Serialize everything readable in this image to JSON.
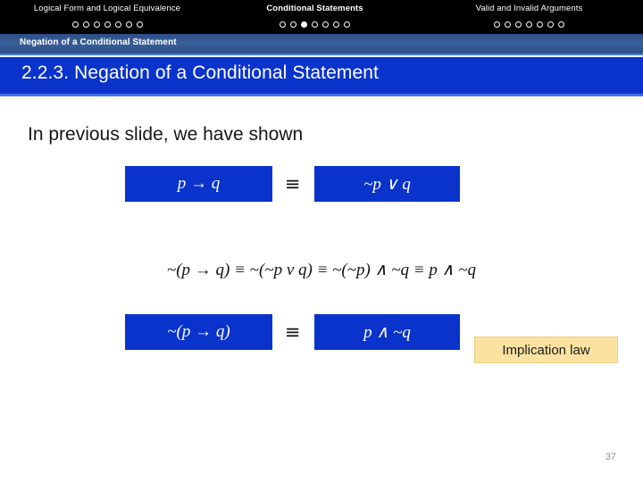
{
  "nav": {
    "groups": [
      {
        "label": "Logical Form and Logical Equivalence",
        "current": false,
        "dots": [
          false,
          false,
          false,
          false,
          false,
          false,
          false
        ]
      },
      {
        "label": "Conditional Statements",
        "current": true,
        "dots": [
          false,
          false,
          true,
          false,
          false,
          false,
          false
        ]
      },
      {
        "label": "Valid and Invalid Arguments",
        "current": false,
        "dots": [
          false,
          false,
          false,
          false,
          false,
          false,
          false
        ]
      }
    ]
  },
  "section_ribbon": {
    "label": "Negation of a Conditional Statement"
  },
  "title_band": {
    "title": "2.2.3. Negation of a Conditional Statement"
  },
  "body": {
    "intro_text": "In previous slide, we have shown",
    "row1": {
      "left_box": "p → q",
      "equiv": "≡",
      "right_box": "~p ∨ q",
      "law_label": "Implication law"
    },
    "chain": "~(p → q) ≡ ~(~p v q) ≡ ~(~p) ∧ ~q ≡ p ∧ ~q",
    "row2": {
      "left_box": "~(p → q)",
      "equiv": "≡",
      "right_box": "p ∧ ~q"
    }
  },
  "footer": {
    "page_number": "37"
  },
  "colors": {
    "nav_background": "#000000",
    "ribbon_blue": "#35568f",
    "title_blue": "#0a33cc",
    "box_blue": "#0a33cc",
    "law_yellow": "#fbe2a0",
    "page_number_gray": "#8c8c8c"
  }
}
